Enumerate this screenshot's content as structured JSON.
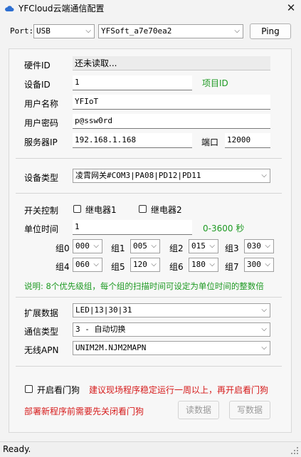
{
  "window": {
    "title": "YFCloud云端通信配置",
    "close_symbol": "✕"
  },
  "top": {
    "port_label": "Port:",
    "port_value": "USB",
    "device_value": "YFSoft_a7e70ea2",
    "ping_label": "Ping"
  },
  "form": {
    "hardware_id_label": "硬件ID",
    "hardware_id_value": "还未读取...",
    "device_id_label": "设备ID",
    "device_id_value": "1",
    "project_id_label": "项目ID",
    "username_label": "用户名称",
    "username_value": "YFIoT",
    "password_label": "用户密码",
    "password_value": "p@ssw0rd",
    "server_ip_label": "服务器IP",
    "server_ip_value": "192.168.1.168",
    "port_label": "端口",
    "port_value": "12000",
    "device_type_label": "设备类型",
    "device_type_value": "凌霄网关#COM3|PA08|PD12|PD11",
    "switch_label": "开关控制",
    "relay1_label": "继电器1",
    "relay2_label": "继电器2",
    "unit_time_label": "单位时间",
    "unit_time_value": "1",
    "unit_time_range": "0-3600 秒",
    "groups": [
      {
        "label": "组0",
        "value": "000"
      },
      {
        "label": "组1",
        "value": "005"
      },
      {
        "label": "组2",
        "value": "015"
      },
      {
        "label": "组3",
        "value": "030"
      },
      {
        "label": "组4",
        "value": "060"
      },
      {
        "label": "组5",
        "value": "120"
      },
      {
        "label": "组6",
        "value": "180"
      },
      {
        "label": "组7",
        "value": "300"
      }
    ],
    "note": "说明: 8个优先级组，每个组的扫描时间可设定为单位时间的整数倍",
    "ext_data_label": "扩展数据",
    "ext_data_value": "LED|13|30|31",
    "comm_type_label": "通信类型",
    "comm_type_value": "3 - 自动切换",
    "apn_label": "无线APN",
    "apn_value": "UNIM2M.NJM2MAPN",
    "watchdog_label": "开启看门狗",
    "watchdog_note": "建议现场程序稳定运行一周以上，再开启看门狗",
    "deploy_note": "部署新程序前需要先关闭看门狗",
    "read_button": "读数据",
    "write_button": "写数据"
  },
  "status": {
    "text": "Ready."
  },
  "colors": {
    "note_green": "#1e9a23",
    "warning_red": "#d61b1b"
  },
  "icons": {
    "app": "cloud-icon",
    "dropdown": "chevron-down-icon",
    "close": "close-icon"
  }
}
